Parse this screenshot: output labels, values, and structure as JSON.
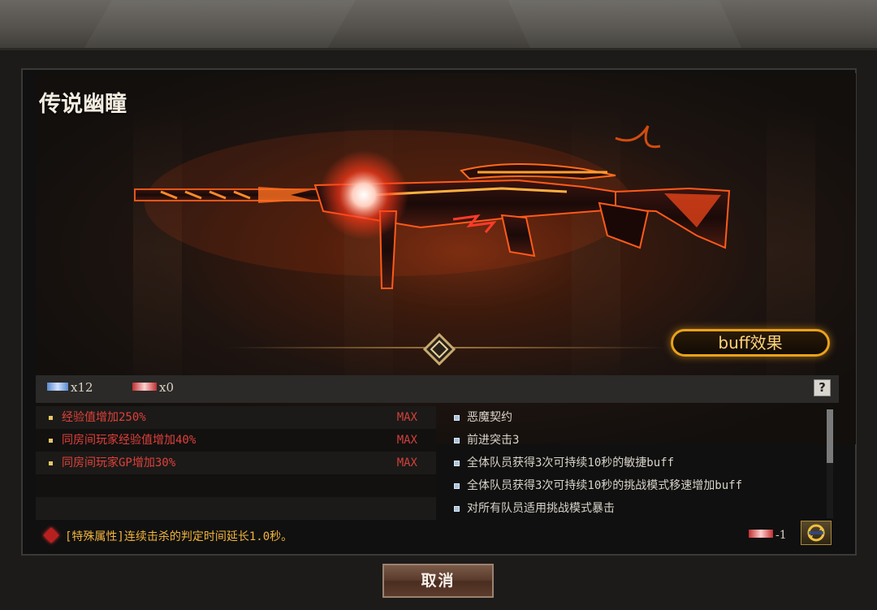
{
  "item": {
    "title": "传说幽瞳"
  },
  "buff_button": "buff效果",
  "counts": {
    "blue_count": "x12",
    "red_count": "x0"
  },
  "help_label": "?",
  "left_attributes": [
    {
      "text": "经验值增加250%",
      "level": "MAX"
    },
    {
      "text": "同房间玩家经验值增加40%",
      "level": "MAX"
    },
    {
      "text": "同房间玩家GP增加30%",
      "level": "MAX"
    }
  ],
  "right_features": [
    "恶魔契约",
    "前进突击3",
    "全体队员获得3次可持续10秒的敏捷buff",
    "全体队员获得3次可持续10秒的挑战模式移速增加buff",
    "对所有队员适用挑战模式暴击"
  ],
  "special_attribute": "[特殊属性]连续击杀的判定时间延长1.0秒。",
  "cost": "-1",
  "cancel_button": "取消",
  "colors": {
    "accent_gold": "#e9a21a",
    "attribute_red": "#e0403a",
    "special_orange": "#f1b43d"
  },
  "icons": [
    "diamond-emblem-icon",
    "blue-token-icon",
    "red-token-icon",
    "red-gem-icon",
    "refresh-icon",
    "help-icon"
  ]
}
